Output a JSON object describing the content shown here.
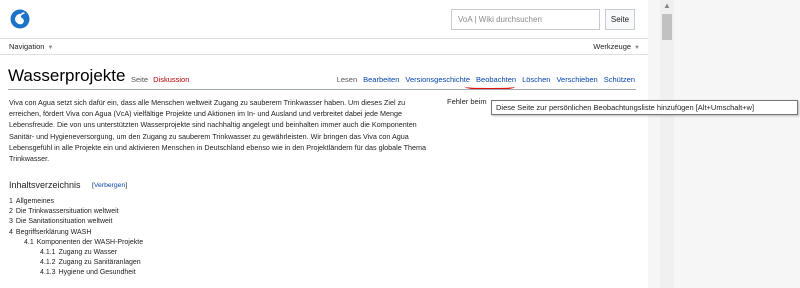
{
  "search": {
    "placeholder": "VoA | Wiki durchsuchen",
    "button_label": "Seite"
  },
  "nav": {
    "navigation_label": "Navigation",
    "tools_label": "Werkzeuge"
  },
  "page": {
    "title": "Wasserprojekte",
    "tabs": [
      {
        "label": "Seite",
        "state": "selected"
      },
      {
        "label": "Diskussion",
        "state": "missing"
      }
    ],
    "actions": [
      {
        "label": "Lesen",
        "state": "selected"
      },
      {
        "label": "Bearbeiten",
        "state": "link"
      },
      {
        "label": "Versionsgeschichte",
        "state": "link"
      },
      {
        "label": "Beobachten",
        "state": "link"
      },
      {
        "label": "Löschen",
        "state": "link"
      },
      {
        "label": "Verschieben",
        "state": "link"
      },
      {
        "label": "Schützen",
        "state": "link"
      }
    ],
    "intro": "Viva con Agua setzt sich dafür ein, dass alle Menschen weltweit Zugang zu sauberem Trinkwasser haben. Um dieses Ziel zu erreichen, fördert Viva con Agua (VcA) vielfältige Projekte und Aktionen im In- und Ausland und verbreitet dabei jede Menge Lebensfreude. Die von uns unterstützten Wasserprojekte sind nachhaltig angelegt und beinhalten immer auch die Komponenten Sanitär- und Hygieneversorgung, um den Zugang zu sauberem Trinkwasser zu gewährleisten. Wir bringen das Viva con Agua Lebensgefühl in alle Projekte ein und aktivieren Menschen in Deutschland ebenso wie in den Projektländern für das globale Thema Trinkwasser.",
    "infobox_text": "Fehler beim"
  },
  "tooltip": {
    "text": "Diese Seite zur persönlichen Beobachtungsliste hinzufügen [Alt+Umschalt+w]"
  },
  "toc": {
    "title": "Inhaltsverzeichnis",
    "toggle_open": "[",
    "toggle_label": "Verbergen",
    "toggle_close": "]",
    "items": [
      {
        "number": "1",
        "text": "Allgemeines",
        "level": 1
      },
      {
        "number": "2",
        "text": "Die Trinkwassersituation weltweit",
        "level": 1
      },
      {
        "number": "3",
        "text": "Die Sanitationsituation weltweit",
        "level": 1
      },
      {
        "number": "4",
        "text": "Begriffserklärung WASH",
        "level": 1
      },
      {
        "number": "4.1",
        "text": "Komponenten der WASH-Projekte",
        "level": 2
      },
      {
        "number": "4.1.1",
        "text": "Zugang zu Wasser",
        "level": 3
      },
      {
        "number": "4.1.2",
        "text": "Zugang zu Sanitäranlagen",
        "level": 3
      },
      {
        "number": "4.1.3",
        "text": "Hygiene und Gesundheit",
        "level": 3
      }
    ]
  },
  "icons": {
    "logo": "wiki-logo-icon",
    "caret": "chevron-down-icon",
    "scroll_up": "scroll-up-arrow-icon"
  },
  "colors": {
    "link": "#0645ad",
    "missing_link": "#ba0000",
    "highlight": "#e01010"
  }
}
